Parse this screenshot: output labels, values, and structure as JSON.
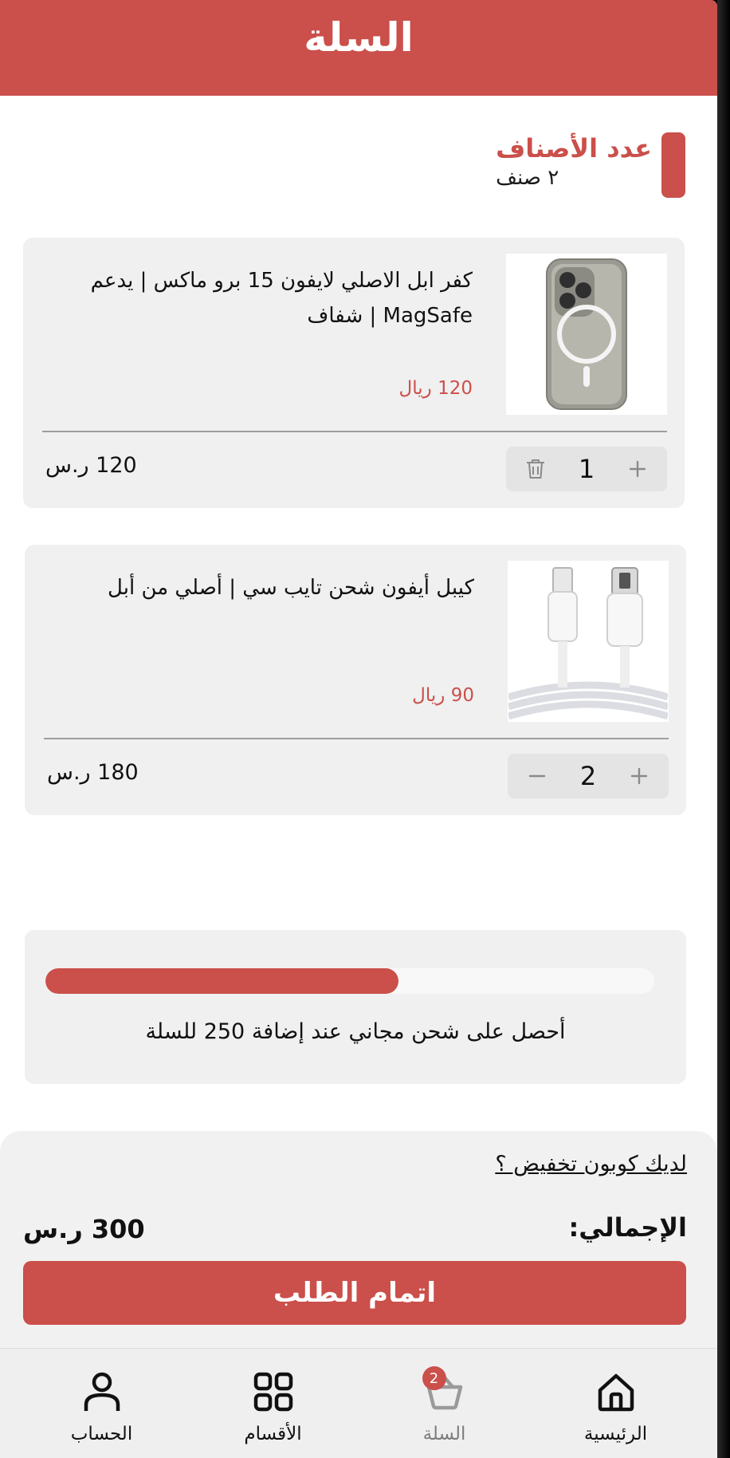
{
  "header": {
    "title": "السلة"
  },
  "summary": {
    "count_label": "عدد الأصناف",
    "count_value": "٢ صنف"
  },
  "cart": {
    "items": [
      {
        "name": "كفر ابل الاصلي لايفون 15 برو ماكس | يدعم MagSafe | شفاف",
        "unit_price": "120 ريال",
        "quantity": "1",
        "line_total": "120 ر.س",
        "image_icon": "clear-magsafe-case-image",
        "decrement_icon": "trash-icon",
        "increment_icon": "plus-icon"
      },
      {
        "name": "كيبل أيفون شحن تايب سي | أصلي من أبل",
        "unit_price": "90 ريال",
        "quantity": "2",
        "line_total": "180 ر.س",
        "image_icon": "usb-c-lightning-cable-image",
        "decrement_icon": "minus-icon",
        "increment_icon": "plus-icon"
      }
    ]
  },
  "shipping": {
    "progress_fraction": 0.58,
    "message": "أحصل على شحن مجاني عند إضافة 250 للسلة"
  },
  "checkout": {
    "coupon_link": "لديك كوبون تخفيض ؟",
    "total_label": "الإجمالي:",
    "total_value": "300 ر.س",
    "button_label": "اتمام الطلب"
  },
  "nav": {
    "items": [
      {
        "label": "الرئيسية",
        "icon": "home-icon"
      },
      {
        "label": "السلة",
        "icon": "basket-icon",
        "badge": "2",
        "active": true
      },
      {
        "label": "الأقسام",
        "icon": "grid-icon"
      },
      {
        "label": "الحساب",
        "icon": "user-icon"
      }
    ]
  },
  "colors": {
    "brand": "#cb4f4a",
    "card": "#f0f0f0",
    "nav": "#efeff0"
  }
}
